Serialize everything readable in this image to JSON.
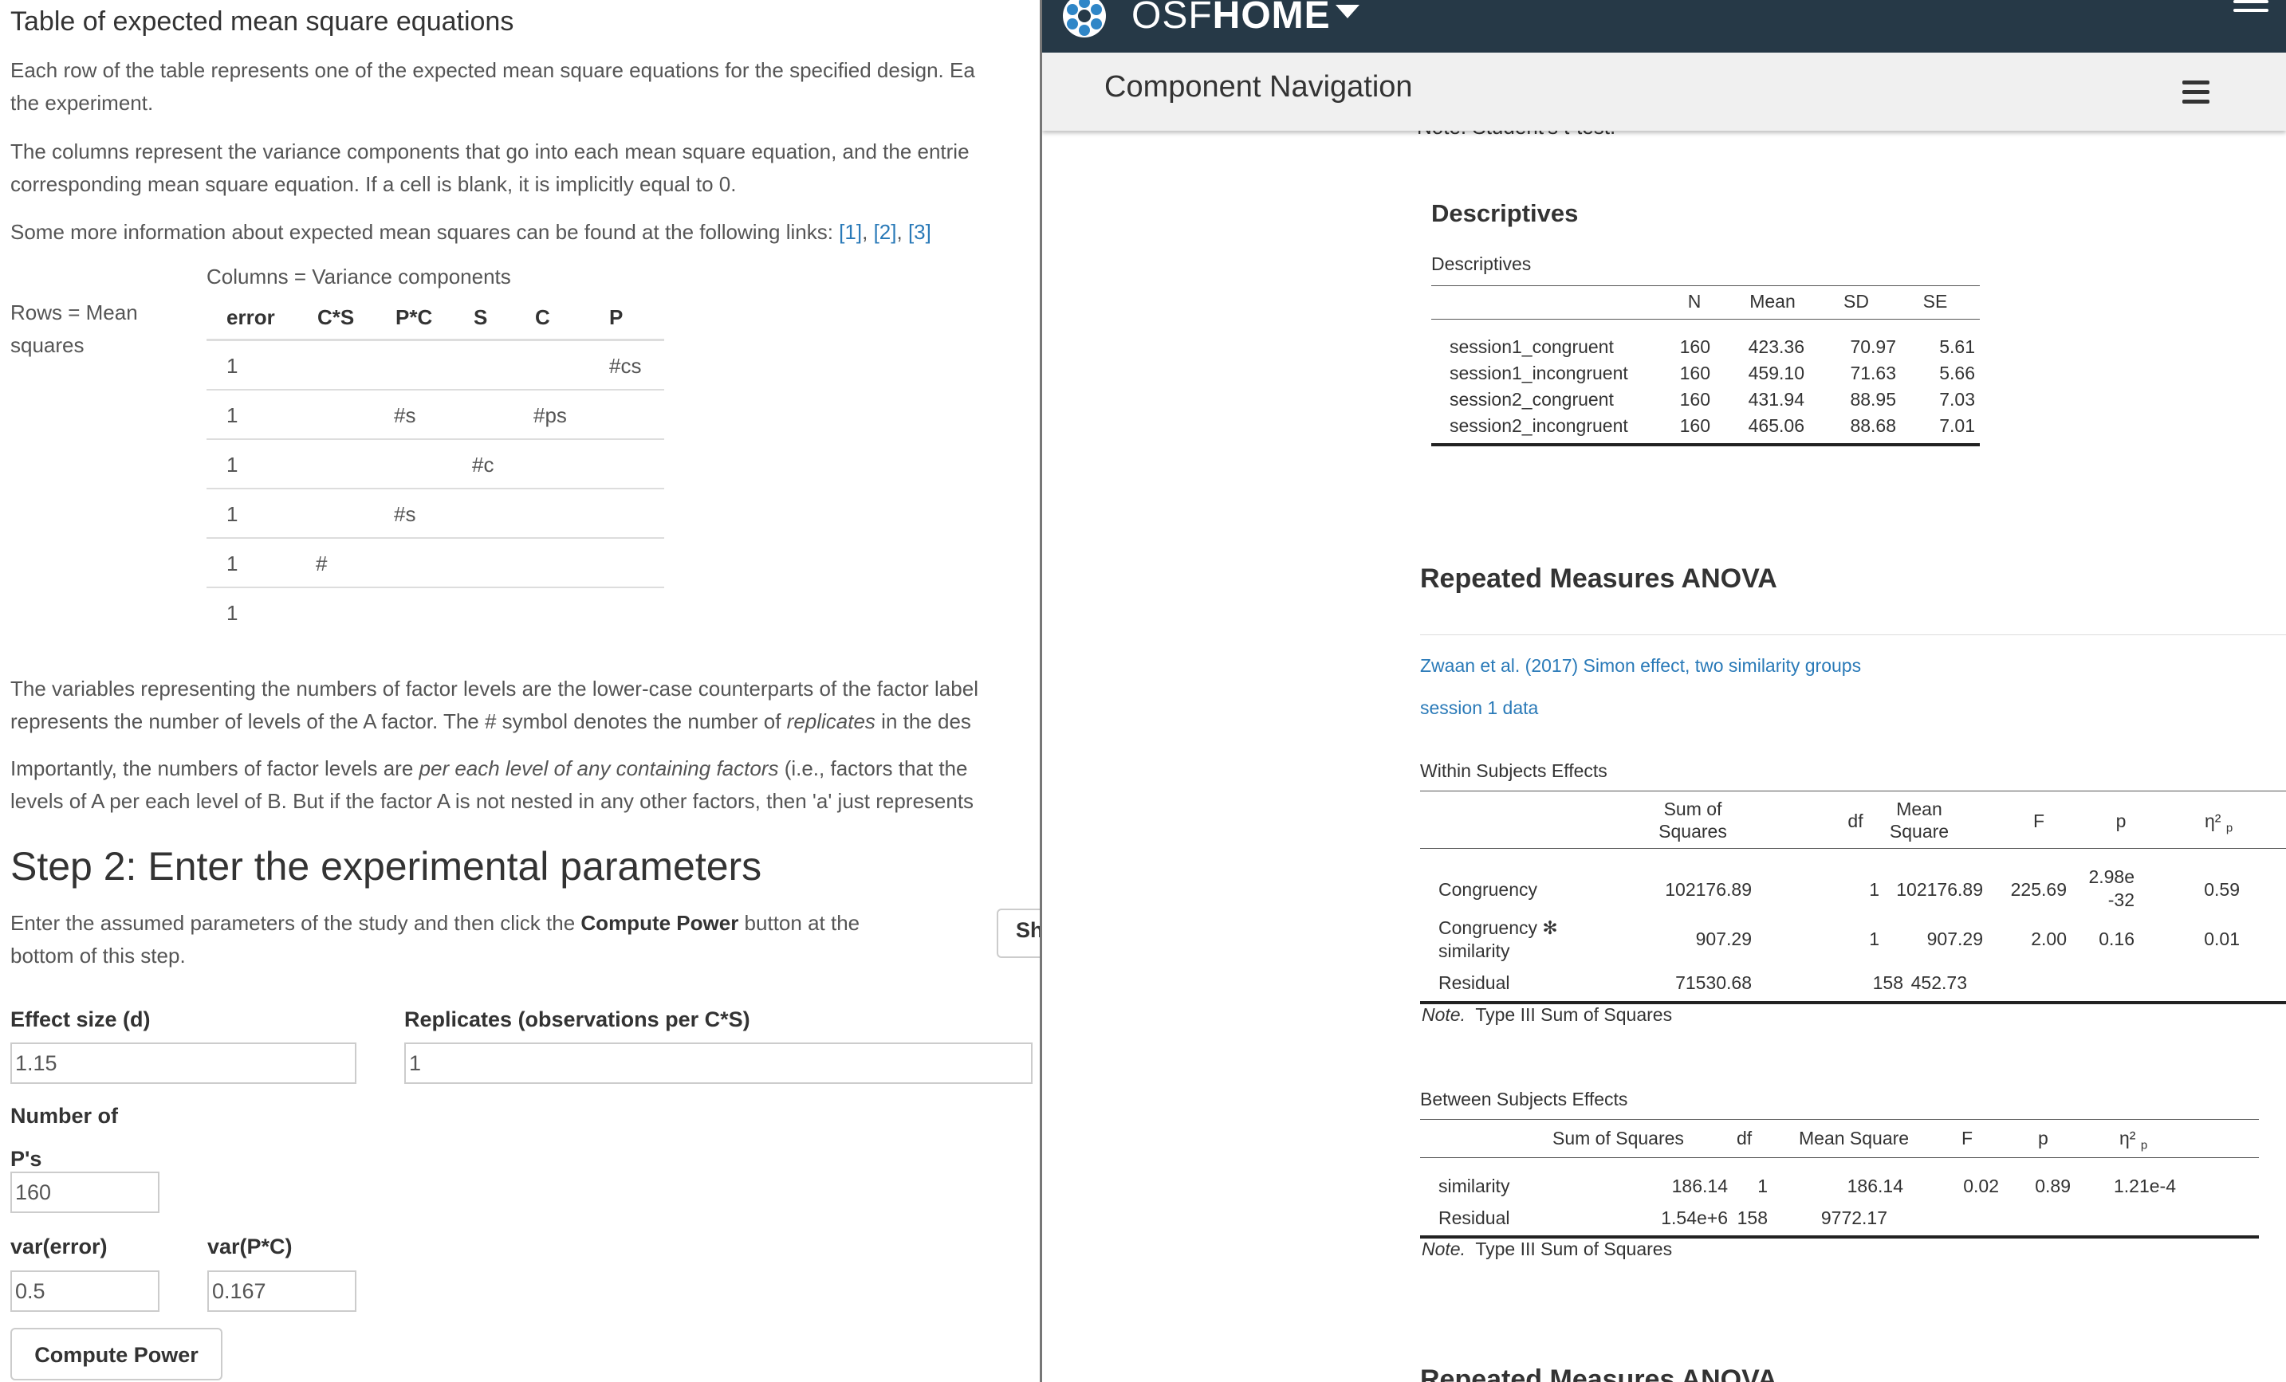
{
  "emt": {
    "title": "Table of expected mean square equations",
    "para1_line1": "Each row of the table represents one of the expected mean square equations for the specified design. Ea",
    "para1_line2": "the experiment.",
    "para2_line1": "The columns represent the variance components that go into each mean square equation, and the entrie",
    "para2_line2": "corresponding mean square equation. If a cell is blank, it is implicitly equal to 0.",
    "para3_text": "Some more information about expected mean squares can be found at the following links: ",
    "links": [
      "[1]",
      "[2]",
      "[3]"
    ],
    "link_sep": ",",
    "columns_caption": "Columns = Variance components",
    "rows_caption": "Rows = Mean squares",
    "headers": [
      "error",
      "C*S",
      "P*C",
      "S",
      "C",
      "P"
    ],
    "rows": [
      [
        "1",
        "",
        "",
        "",
        "",
        "#cs"
      ],
      [
        "1",
        "",
        "#s",
        "",
        "#ps",
        ""
      ],
      [
        "1",
        "",
        "",
        "#c",
        "",
        ""
      ],
      [
        "1",
        "",
        "#s",
        "",
        "",
        ""
      ],
      [
        "1",
        "#",
        "",
        "",
        "",
        ""
      ],
      [
        "1",
        "",
        "",
        "",
        "",
        ""
      ]
    ],
    "para4_line1": "The variables representing the numbers of factor levels are the lower-case counterparts of the factor label",
    "para4_line2_a": "represents the number of levels of the A factor. The # symbol denotes the number of ",
    "para4_line2_em": "replicates",
    "para4_line2_b": " in the des",
    "para5_line1_a": "Importantly, the numbers of factor levels are ",
    "para5_line1_em": "per each level of any containing factors",
    "para5_line1_b": " (i.e., factors that the",
    "para5_line2": "levels of A per each level of B. But if the factor A is not nested in any other factors, then 'a' just represents"
  },
  "step2": {
    "heading": "Step 2: Enter the experimental parameters",
    "intro_a": "Enter the assumed parameters of the study and then click the ",
    "intro_b": "Compute Power",
    "intro_c": " button at the",
    "intro_line2": "bottom of this step.",
    "show_button": "Sh",
    "effect_label": "Effect size (d)",
    "effect_value": "1.15",
    "replicates_label": "Replicates (observations per C*S)",
    "replicates_value": "1",
    "nps_label_line1": "Number of",
    "nps_label_line2": "P's",
    "nps_value": "160",
    "var_error_label": "var(error)",
    "var_error_value": "0.5",
    "var_pc_label": "var(P*C)",
    "var_pc_value": "0.167",
    "compute_button": "Compute Power"
  },
  "osf": {
    "brand_light": "OSF",
    "brand_bold": "HOME",
    "component_nav": "Component Navigation",
    "clipped_note": "Note. Student's t-test."
  },
  "descriptives": {
    "heading": "Descriptives",
    "subtitle": "Descriptives",
    "columns": [
      "N",
      "Mean",
      "SD",
      "SE"
    ],
    "rows": [
      {
        "name": "session1_congruent",
        "n": "160",
        "mean": "423.36",
        "sd": "70.97",
        "se": "5.61"
      },
      {
        "name": "session1_incongruent",
        "n": "160",
        "mean": "459.10",
        "sd": "71.63",
        "se": "5.66"
      },
      {
        "name": "session2_congruent",
        "n": "160",
        "mean": "431.94",
        "sd": "88.95",
        "se": "7.03"
      },
      {
        "name": "session2_incongruent",
        "n": "160",
        "mean": "465.06",
        "sd": "88.68",
        "se": "7.01"
      }
    ]
  },
  "rm_anova": {
    "heading": "Repeated Measures ANOVA",
    "link1": "Zwaan et al. (2017) Simon effect, two similarity groups",
    "link2": "session 1 data",
    "within": {
      "title": "Within Subjects Effects",
      "col_ss_1": "Sum of",
      "col_ss_2": "Squares",
      "col_df": "df",
      "col_ms_1": "Mean",
      "col_ms_2": "Square",
      "col_f": "F",
      "col_p": "p",
      "col_eta": "η²",
      "col_eta_sub": "p",
      "rows": [
        {
          "name1": "Congruency",
          "name2": "",
          "ss": "102176.89",
          "df": "1",
          "ms": "102176.89",
          "f": "225.69",
          "p1": "2.98e",
          "p2": "-32",
          "eta": "0.59"
        },
        {
          "name1": "Congruency ✻",
          "name2": "similarity",
          "ss": "907.29",
          "df": "1",
          "ms": "907.29",
          "f": "2.00",
          "p1": "0.16",
          "p2": "",
          "eta": "0.01"
        },
        {
          "name1": "Residual",
          "name2": "",
          "ss": "71530.68",
          "df": "158",
          "ms": "452.73",
          "f": "",
          "p1": "",
          "p2": "",
          "eta": ""
        }
      ],
      "note_label": "Note.",
      "note_text": "Type III Sum of Squares"
    },
    "between": {
      "title": "Between Subjects Effects",
      "columns": [
        "Sum of Squares",
        "df",
        "Mean Square",
        "F",
        "p",
        "η²"
      ],
      "col_eta_sub": "p",
      "rows": [
        {
          "name": "similarity",
          "ss": "186.14",
          "df": "1",
          "ms": "186.14",
          "f": "0.02",
          "p": "0.89",
          "eta": "1.21e-4"
        },
        {
          "name": "Residual",
          "ss": "1.54e+6",
          "df": "158",
          "ms": "9772.17",
          "f": "",
          "p": "",
          "eta": ""
        }
      ],
      "note_label": "Note.",
      "note_text": "Type III Sum of Squares"
    },
    "next_heading_partial": "Repeated Measures ANOVA"
  },
  "colors": {
    "link": "#2a7ab8",
    "osf_navbar": "#263947",
    "component_nav_bg": "#f0f0f0",
    "text": "#333333",
    "muted_text": "#555555"
  }
}
